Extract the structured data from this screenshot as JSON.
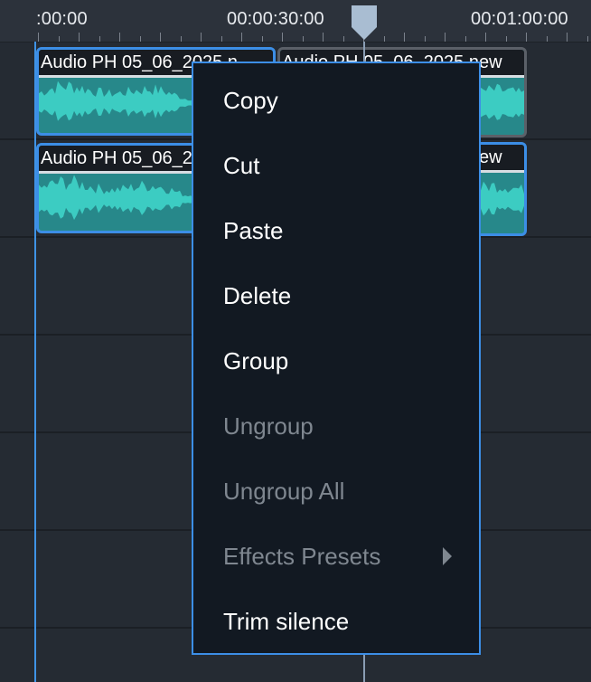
{
  "ruler": {
    "labels": [
      ":00:00",
      "00:00:30:00",
      "00:01:00:00"
    ]
  },
  "clips": [
    {
      "title": "Audio PH 05_06_2025 n",
      "selected": true
    },
    {
      "title": "Audio PH 05_06_2025 new",
      "selected": false
    },
    {
      "title": "Audio PH 05_06_2025 new",
      "selected": true
    },
    {
      "title": "Audio PH 05_06_2025 new",
      "selected": true
    }
  ],
  "context_menu": {
    "items": [
      {
        "label": "Copy",
        "enabled": true
      },
      {
        "label": "Cut",
        "enabled": true
      },
      {
        "label": "Paste",
        "enabled": true
      },
      {
        "label": "Delete",
        "enabled": true
      },
      {
        "label": "Group",
        "enabled": true
      },
      {
        "label": "Ungroup",
        "enabled": false
      },
      {
        "label": "Ungroup All",
        "enabled": false
      },
      {
        "label": "Effects Presets",
        "enabled": false,
        "submenu": true
      },
      {
        "label": "Trim silence",
        "enabled": true
      }
    ]
  },
  "colors": {
    "accent": "#3c8ee6",
    "waveform": "#3fd4c8",
    "clip_background": "#27888a",
    "menu_background": "#121922",
    "disabled_text": "#7f8790"
  }
}
